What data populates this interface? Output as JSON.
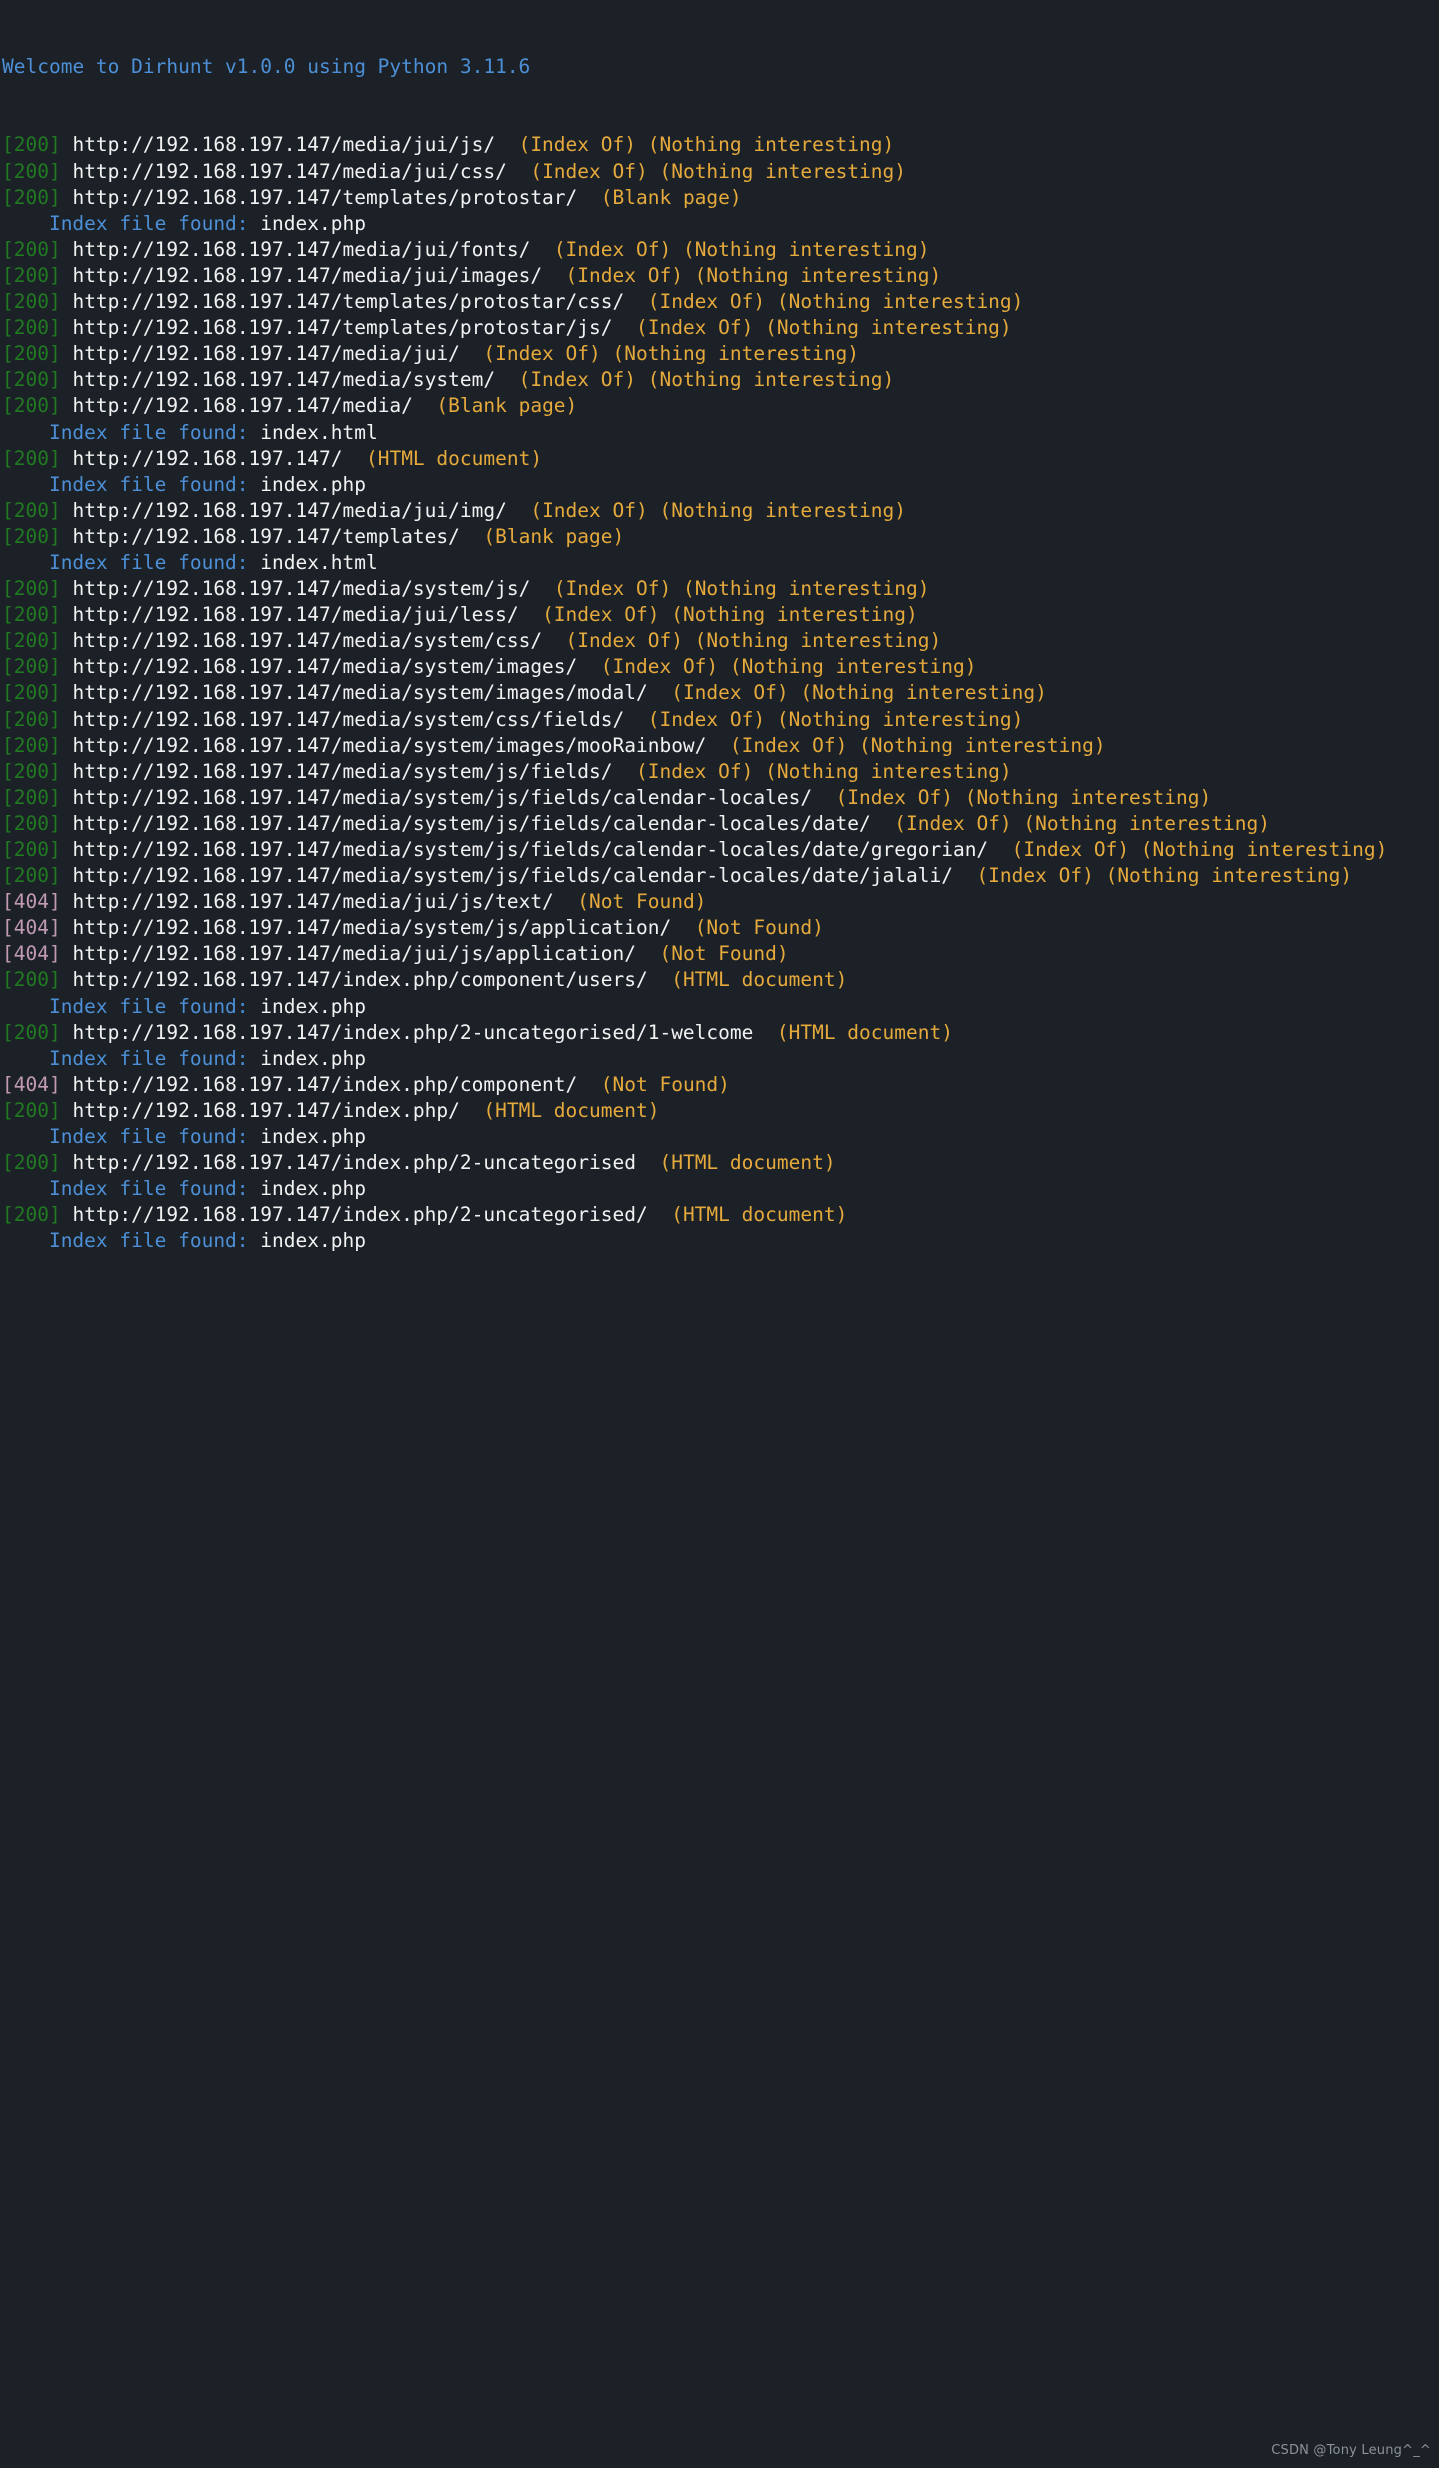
{
  "terminal": {
    "background_color": "#1b2127",
    "colors": {
      "welcome": "#4d8fd6",
      "status_200": "#217a21",
      "status_404": "#c39ab4",
      "url": "#f2f2f2",
      "tag": "#e5a93c",
      "index_label": "#4d8fd6",
      "index_file": "#f2f2f2",
      "watermark": "#8c9298"
    },
    "header": "Welcome to Dirhunt v1.0.0 using Python 3.11.6",
    "host": "http://192.168.197.147",
    "index_label": "Index file found:",
    "lines": [
      {
        "kind": "result",
        "status": "[200]",
        "url": "http://192.168.197.147/media/jui/js/",
        "tags": "(Index Of) (Nothing interesting)"
      },
      {
        "kind": "result",
        "status": "[200]",
        "url": "http://192.168.197.147/media/jui/css/",
        "tags": "(Index Of) (Nothing interesting)"
      },
      {
        "kind": "result",
        "status": "[200]",
        "url": "http://192.168.197.147/templates/protostar/",
        "tags": "(Blank page)"
      },
      {
        "kind": "index",
        "label": "Index file found:",
        "file": "index.php"
      },
      {
        "kind": "result",
        "status": "[200]",
        "url": "http://192.168.197.147/media/jui/fonts/",
        "tags": "(Index Of) (Nothing interesting)"
      },
      {
        "kind": "result",
        "status": "[200]",
        "url": "http://192.168.197.147/media/jui/images/",
        "tags": "(Index Of) (Nothing interesting)"
      },
      {
        "kind": "result",
        "status": "[200]",
        "url": "http://192.168.197.147/templates/protostar/css/",
        "tags": "(Index Of) (Nothing interesting)"
      },
      {
        "kind": "result",
        "status": "[200]",
        "url": "http://192.168.197.147/templates/protostar/js/",
        "tags": "(Index Of) (Nothing interesting)"
      },
      {
        "kind": "result",
        "status": "[200]",
        "url": "http://192.168.197.147/media/jui/",
        "tags": "(Index Of) (Nothing interesting)"
      },
      {
        "kind": "result",
        "status": "[200]",
        "url": "http://192.168.197.147/media/system/",
        "tags": "(Index Of) (Nothing interesting)"
      },
      {
        "kind": "result",
        "status": "[200]",
        "url": "http://192.168.197.147/media/",
        "tags": "(Blank page)"
      },
      {
        "kind": "index",
        "label": "Index file found:",
        "file": "index.html"
      },
      {
        "kind": "result",
        "status": "[200]",
        "url": "http://192.168.197.147/",
        "tags": "(HTML document)"
      },
      {
        "kind": "index",
        "label": "Index file found:",
        "file": "index.php"
      },
      {
        "kind": "result",
        "status": "[200]",
        "url": "http://192.168.197.147/media/jui/img/",
        "tags": "(Index Of) (Nothing interesting)"
      },
      {
        "kind": "result",
        "status": "[200]",
        "url": "http://192.168.197.147/templates/",
        "tags": "(Blank page)"
      },
      {
        "kind": "index",
        "label": "Index file found:",
        "file": "index.html"
      },
      {
        "kind": "result",
        "status": "[200]",
        "url": "http://192.168.197.147/media/system/js/",
        "tags": "(Index Of) (Nothing interesting)"
      },
      {
        "kind": "result",
        "status": "[200]",
        "url": "http://192.168.197.147/media/jui/less/",
        "tags": "(Index Of) (Nothing interesting)"
      },
      {
        "kind": "result",
        "status": "[200]",
        "url": "http://192.168.197.147/media/system/css/",
        "tags": "(Index Of) (Nothing interesting)"
      },
      {
        "kind": "result",
        "status": "[200]",
        "url": "http://192.168.197.147/media/system/images/",
        "tags": "(Index Of) (Nothing interesting)"
      },
      {
        "kind": "result",
        "status": "[200]",
        "url": "http://192.168.197.147/media/system/images/modal/",
        "tags": "(Index Of) (Nothing interesting)"
      },
      {
        "kind": "result",
        "status": "[200]",
        "url": "http://192.168.197.147/media/system/css/fields/",
        "tags": "(Index Of) (Nothing interesting)"
      },
      {
        "kind": "result",
        "status": "[200]",
        "url": "http://192.168.197.147/media/system/images/mooRainbow/",
        "tags": "(Index Of) (Nothing interesting)"
      },
      {
        "kind": "result",
        "status": "[200]",
        "url": "http://192.168.197.147/media/system/js/fields/",
        "tags": "(Index Of) (Nothing interesting)"
      },
      {
        "kind": "result",
        "status": "[200]",
        "url": "http://192.168.197.147/media/system/js/fields/calendar-locales/",
        "tags": "(Index Of) (Nothing interesting)"
      },
      {
        "kind": "result",
        "status": "[200]",
        "url": "http://192.168.197.147/media/system/js/fields/calendar-locales/date/",
        "tags": "(Index Of) (Nothing interesting)"
      },
      {
        "kind": "result",
        "status": "[200]",
        "url": "http://192.168.197.147/media/system/js/fields/calendar-locales/date/gregorian/",
        "tags": "(Index Of) (Nothing interesting)"
      },
      {
        "kind": "result",
        "status": "[200]",
        "url": "http://192.168.197.147/media/system/js/fields/calendar-locales/date/jalali/",
        "tags": "(Index Of) (Nothing interesting)"
      },
      {
        "kind": "result",
        "status": "[404]",
        "url": "http://192.168.197.147/media/jui/js/text/",
        "tags": "(Not Found)"
      },
      {
        "kind": "result",
        "status": "[404]",
        "url": "http://192.168.197.147/media/system/js/application/",
        "tags": "(Not Found)"
      },
      {
        "kind": "result",
        "status": "[404]",
        "url": "http://192.168.197.147/media/jui/js/application/",
        "tags": "(Not Found)"
      },
      {
        "kind": "result",
        "status": "[200]",
        "url": "http://192.168.197.147/index.php/component/users/",
        "tags": "(HTML document)"
      },
      {
        "kind": "index",
        "label": "Index file found:",
        "file": "index.php"
      },
      {
        "kind": "result",
        "status": "[200]",
        "url": "http://192.168.197.147/index.php/2-uncategorised/1-welcome",
        "tags": "(HTML document)"
      },
      {
        "kind": "index",
        "label": "Index file found:",
        "file": "index.php"
      },
      {
        "kind": "result",
        "status": "[404]",
        "url": "http://192.168.197.147/index.php/component/",
        "tags": "(Not Found)"
      },
      {
        "kind": "result",
        "status": "[200]",
        "url": "http://192.168.197.147/index.php/",
        "tags": "(HTML document)"
      },
      {
        "kind": "index",
        "label": "Index file found:",
        "file": "index.php"
      },
      {
        "kind": "result",
        "status": "[200]",
        "url": "http://192.168.197.147/index.php/2-uncategorised",
        "tags": "(HTML document)"
      },
      {
        "kind": "index",
        "label": "Index file found:",
        "file": "index.php"
      },
      {
        "kind": "result",
        "status": "[200]",
        "url": "http://192.168.197.147/index.php/2-uncategorised/",
        "tags": "(HTML document)"
      },
      {
        "kind": "index",
        "label": "Index file found:",
        "file": "index.php"
      }
    ]
  },
  "watermark": "CSDN @Tony Leung^_^"
}
